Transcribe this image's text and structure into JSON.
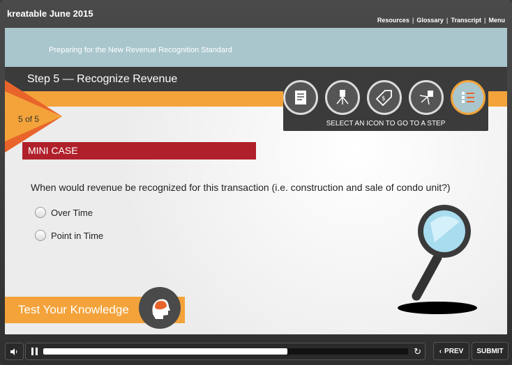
{
  "header": {
    "course_title": "kreatable June 2015",
    "links": [
      "Resources",
      "Glossary",
      "Transcript",
      "Menu"
    ]
  },
  "banner": {
    "title": "Preparing for the New Revenue Recognition Standard"
  },
  "step": {
    "title": "Step 5 — Recognize Revenue",
    "progress": "5 of 5"
  },
  "step_nav": {
    "label": "SELECT AN ICON TO GO TO A STEP",
    "icons": [
      "contract-icon",
      "obligations-icon",
      "price-tag-icon",
      "allocate-price-icon",
      "checklist-icon"
    ],
    "active_index": 4
  },
  "section": {
    "label": "MINI CASE"
  },
  "question": {
    "text": "When would revenue be recognized for this transaction (i.e. construction and sale of condo unit?)",
    "options": [
      "Over Time",
      "Point in Time"
    ]
  },
  "badge": {
    "label": "Test Your Knowledge"
  },
  "player": {
    "progress_fraction": 0.67,
    "prev_label": "PREV",
    "submit_label": "SUBMIT"
  },
  "colors": {
    "accent_orange": "#f3a33a",
    "accent_red": "#b0202a",
    "banner_blue": "#a9c6cd",
    "dark": "#3b3b3b"
  }
}
